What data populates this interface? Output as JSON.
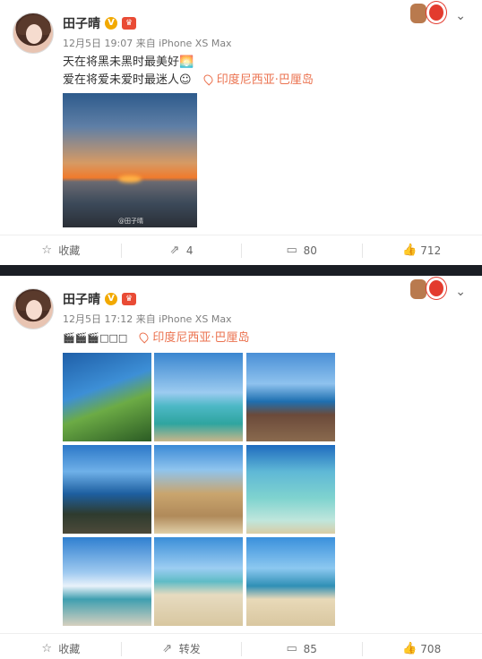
{
  "posts": [
    {
      "username": "田子晴",
      "meta": "12月5日 19:07 来自 iPhone XS Max",
      "text_line1": "天在将黑未黑时最美好",
      "text_line2": "爱在将爱未爱时最迷人",
      "location": "印度尼西亚·巴厘岛",
      "photo_watermark": "@田子晴",
      "actions": {
        "favorite": "收藏",
        "repost": "4",
        "comment": "80",
        "like": "712"
      }
    },
    {
      "username": "田子晴",
      "meta": "12月5日 17:12 来自 iPhone XS Max",
      "text_line1": "🎬🎬🎬□□□",
      "location": "印度尼西亚·巴厘岛",
      "actions": {
        "favorite": "收藏",
        "repost": "转发",
        "comment": "85",
        "like": "708"
      }
    }
  ],
  "icons": {
    "vip": "verified-v-badge",
    "crown": "member-crown-icon",
    "chevron": "chevron-down-icon",
    "location": "location-pin-icon",
    "favorite": "star-icon",
    "repost": "repost-icon",
    "comment": "comment-icon",
    "like": "thumbs-up-icon"
  },
  "colors": {
    "accent_location": "#eb7350",
    "divider": "#1a1e24",
    "vip_gold": "#f2a900"
  }
}
